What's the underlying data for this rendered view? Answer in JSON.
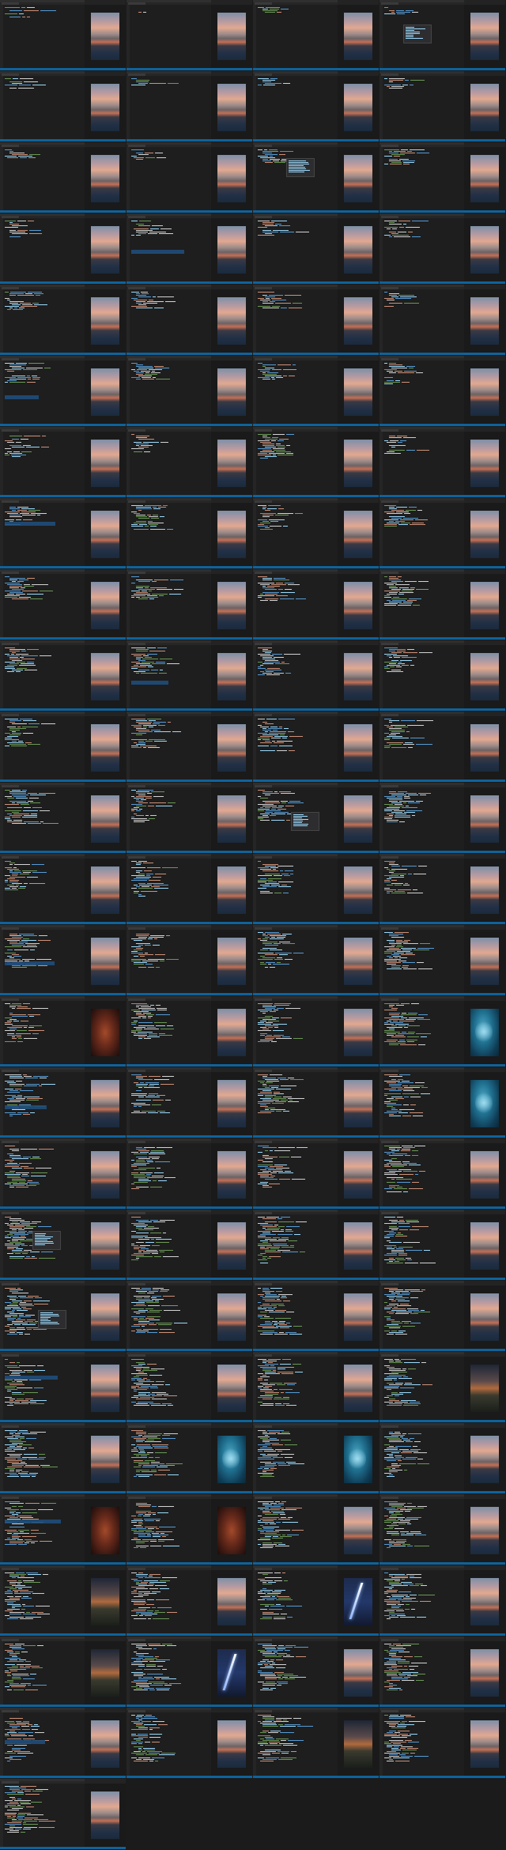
{
  "title": "",
  "grid": {
    "columns": 4,
    "rows": 26,
    "frames": 101
  },
  "theme": {
    "editor_bg": "#1e1e1e",
    "status_bar": "#0e639c",
    "selection": "#1f4d7a",
    "keyword": "#569cd6",
    "string": "#ce9178",
    "variable": "#9cdcfe",
    "comment": "#6a9955",
    "plain": "#d4d4d4"
  },
  "frames_with_completion_popup": [
    3,
    10,
    46,
    68,
    72
  ],
  "frames_with_selection": [
    13,
    20,
    28,
    37,
    52,
    60,
    76,
    84,
    96
  ],
  "frame_images": {
    "59": "teal-sphere",
    "63": "teal-sphere",
    "56": "fire-texture",
    "79": "dusk-landscape",
    "81": "teal-sphere",
    "82": "teal-sphere",
    "84": "fire-texture",
    "85": "fire-texture",
    "88": "dusk-landscape",
    "90": "lightning",
    "92": "dusk-landscape",
    "93": "lightning",
    "98": "dusk-landscape"
  },
  "default_image": "sunset-photo"
}
